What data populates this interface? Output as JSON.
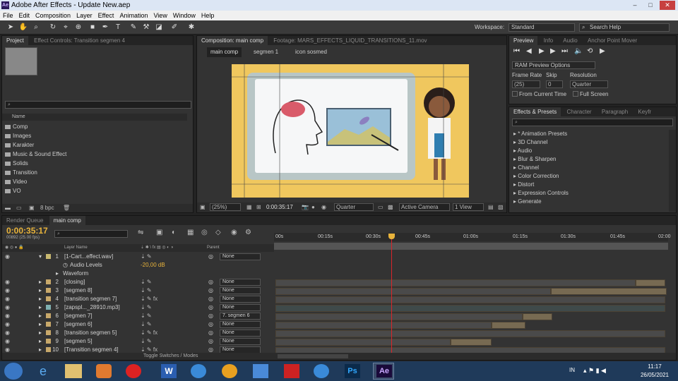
{
  "window": {
    "title": "Adobe After Effects - Update New.aep",
    "app_icon": "Ae"
  },
  "menu": [
    "File",
    "Edit",
    "Composition",
    "Layer",
    "Effect",
    "Animation",
    "View",
    "Window",
    "Help"
  ],
  "workspace": {
    "label": "Workspace:",
    "value": "Standard",
    "search_placeholder": "Search Help"
  },
  "project_panel": {
    "tabs": [
      "Project",
      "Effect Controls: Transition segmen 4"
    ],
    "column_name": "Name",
    "bpc": "8 bpc",
    "items": [
      "Comp",
      "Images",
      "Karakter",
      "Music & Sound Effect",
      "Solids",
      "Transition",
      "Video",
      "VO"
    ]
  },
  "comp_panel": {
    "tabs": [
      "Composition: main comp",
      "Footage: MARS_EFFECTS_LIQUID_TRANSITIONS_11.mov"
    ],
    "breadcrumbs": [
      "main comp",
      "segmen 1",
      "icon sosmed"
    ],
    "footer": {
      "zoom": "(25%)",
      "timecode": "0:00:35:17",
      "resolution": "Quarter",
      "camera": "Active Camera",
      "view": "1 View"
    }
  },
  "preview_panel": {
    "tabs": [
      "Preview",
      "Info",
      "Audio",
      "Anchor Point Mover"
    ],
    "ram_options": "RAM Preview Options",
    "frame_rate_label": "Frame Rate",
    "frame_rate": "(25)",
    "skip_label": "Skip",
    "skip": "0",
    "resolution_label": "Resolution",
    "resolution": "Quarter",
    "from_current": "From Current Time",
    "full_screen": "Full Screen"
  },
  "effects_panel": {
    "tabs": [
      "Effects & Presets",
      "Character",
      "Paragraph",
      "Keyfr"
    ],
    "items": [
      "* Animation Presets",
      "3D Channel",
      "Audio",
      "Blur & Sharpen",
      "Channel",
      "Color Correction",
      "Distort",
      "Expression Controls",
      "Generate"
    ]
  },
  "timeline": {
    "tabs": [
      "Render Queue",
      "main comp"
    ],
    "timecode": "0:00:35:17",
    "frame_info": "00892 (25.00 fps)",
    "col_layer_name": "Layer Name",
    "col_parent": "Parent",
    "ruler": [
      "00s",
      "00:15s",
      "00:30s",
      "00:45s",
      "01:00s",
      "01:15s",
      "01:30s",
      "01:45s",
      "02:00"
    ],
    "audio_levels_label": "Audio Levels",
    "audio_levels_value": "-20,00 dB",
    "waveform_label": "Waveform",
    "layers": [
      {
        "num": "1",
        "name": "[1-Cart...effect.wav]",
        "parent": "None",
        "color": "#c8b870",
        "fx": false
      },
      {
        "num": "2",
        "name": "[closing]",
        "parent": "None",
        "color": "#c8a86a",
        "fx": false
      },
      {
        "num": "3",
        "name": "[segmen 8]",
        "parent": "None",
        "color": "#c8a86a",
        "fx": false
      },
      {
        "num": "4",
        "name": "[transition segmen 7]",
        "parent": "None",
        "color": "#c8a86a",
        "fx": true
      },
      {
        "num": "5",
        "name": "[zapspl..._28910.mp3]",
        "parent": "None",
        "color": "#7fb0b0",
        "fx": false
      },
      {
        "num": "6",
        "name": "[segmen 7]",
        "parent": "7. segmen 6",
        "color": "#c8a86a",
        "fx": false
      },
      {
        "num": "7",
        "name": "[segmen 6]",
        "parent": "None",
        "color": "#c8a86a",
        "fx": false
      },
      {
        "num": "8",
        "name": "[transition segmen 5]",
        "parent": "None",
        "color": "#c8a86a",
        "fx": true
      },
      {
        "num": "9",
        "name": "[segmen 5]",
        "parent": "None",
        "color": "#c8a86a",
        "fx": false
      },
      {
        "num": "10",
        "name": "[Transition segmen 4]",
        "parent": "None",
        "color": "#c8a86a",
        "fx": true
      }
    ],
    "toggle_label": "Toggle Switches / Modes"
  },
  "taskbar": {
    "lang": "IN",
    "time": "11:17",
    "date": "26/05/2021"
  },
  "colors": {
    "accent": "#e8b33b",
    "playhead": "#d9252a",
    "bg_stage": "#f0c75e"
  }
}
